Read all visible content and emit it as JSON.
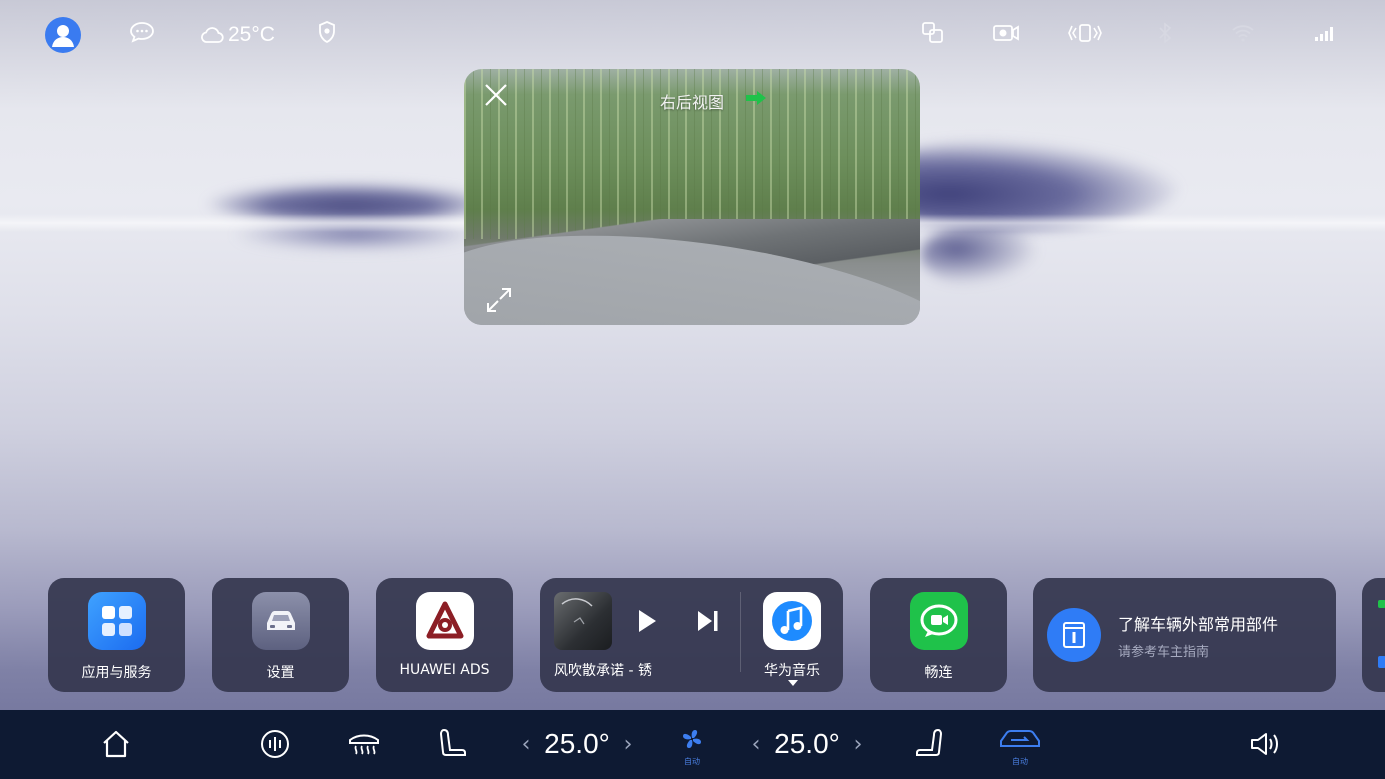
{
  "status_bar": {
    "temperature": "25°C",
    "icons": [
      "avatar-icon",
      "message-icon",
      "cloud-icon",
      "shield-icon",
      "screen-share-icon",
      "camera-icon",
      "vibrate-icon",
      "bluetooth-icon",
      "wifi-icon",
      "signal-icon"
    ]
  },
  "rear_view": {
    "title": "右后视图"
  },
  "cards": {
    "apps": {
      "label": "应用与服务"
    },
    "settings": {
      "label": "设置"
    },
    "ads": {
      "label": "HUAWEI ADS"
    },
    "music": {
      "track": "风吹散承诺 - 锈",
      "app_label": "华为音乐"
    },
    "changlian": {
      "label": "畅连"
    },
    "tip": {
      "title": "了解车辆外部常用部件",
      "subtitle": "请参考车主指南"
    }
  },
  "dock": {
    "left_temp": "25.0°",
    "right_temp": "25.0°",
    "fan_mode": "自动",
    "ac_mode": "自动"
  },
  "colors": {
    "dock_bg": "#0e1a33",
    "card_bg": "#34364e",
    "accent_blue": "#2f7cf6",
    "green": "#1fc24a"
  }
}
